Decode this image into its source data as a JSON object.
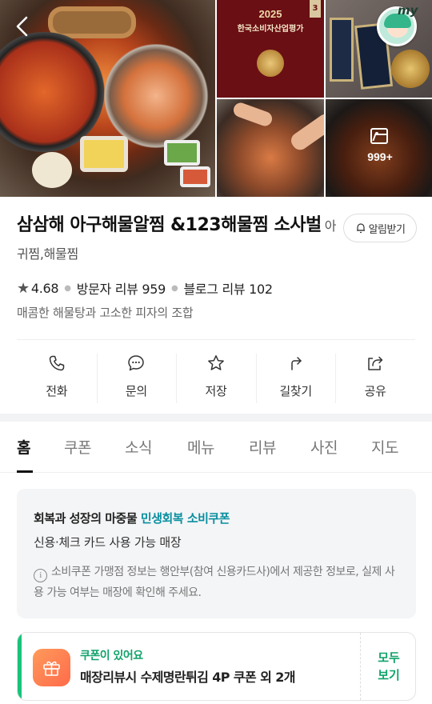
{
  "gallery": {
    "award_year": "2025",
    "award_title": "한국소비자산업평가",
    "more_count": "999+"
  },
  "header": {
    "my_label": "my"
  },
  "place": {
    "name": "삼삼해 아구해물알찜 &123해물찜 소사벌",
    "category": "아귀찜,해물찜",
    "notify_label": "알림받기",
    "rating": "4.68",
    "visitor_reviews": "방문자 리뷰 959",
    "blog_reviews": "블로그 리뷰 102",
    "description": "매콤한 해물탕과 고소한 피자의 조합"
  },
  "actions": [
    {
      "label": "전화",
      "icon": "phone-icon"
    },
    {
      "label": "문의",
      "icon": "chat-icon"
    },
    {
      "label": "저장",
      "icon": "star-icon"
    },
    {
      "label": "길찾기",
      "icon": "directions-icon"
    },
    {
      "label": "공유",
      "icon": "share-icon"
    }
  ],
  "tabs": [
    "홈",
    "쿠폰",
    "소식",
    "메뉴",
    "리뷰",
    "사진",
    "지도"
  ],
  "active_tab": "홈",
  "coupon_info": {
    "line1_prefix": "회복과 성장의 마중물",
    "line1_highlight": "민생회복 소비쿠폰",
    "line2": "신용·체크 카드 사용 가능 매장",
    "line3": "소비쿠폰 가맹점 정보는 행안부(참여 신용카드사)에서 제공한 정보로, 실제 사용 가능 여부는 매장에 확인해 주세요.",
    "info_icon_glyph": "i"
  },
  "coupon_card": {
    "title": "쿠폰이 있어요",
    "text": "매장리뷰시 수제명란튀김 4P 쿠폰 외 2개",
    "view_all_line1": "모두",
    "view_all_line2": "보기"
  },
  "colors": {
    "accent_green": "#11a36b",
    "highlight_teal": "#0a8fa0"
  }
}
